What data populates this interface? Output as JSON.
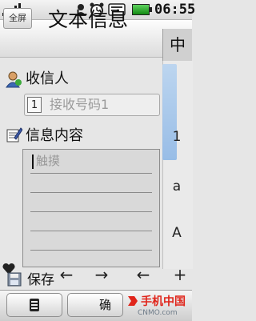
{
  "status_bar": {
    "time": "06:55",
    "icons": [
      "signal-icon",
      "user-icon",
      "alarm-icon",
      "message-icon",
      "battery-icon"
    ]
  },
  "header": {
    "fullscreen_label": "全屏",
    "title": "文本信息",
    "input_mode": "中"
  },
  "recipient": {
    "label": "收信人",
    "index": "1",
    "placeholder": "接收号码1"
  },
  "content": {
    "label": "信息内容",
    "placeholder": "触摸"
  },
  "ime_strip": {
    "keys": [
      "1",
      "a",
      "A"
    ],
    "plus": "+"
  },
  "toolbar": {
    "left_arrow": "←",
    "right_arrow": "→",
    "back_arrow": "←",
    "save_label": "保存"
  },
  "softkeys": {
    "confirm_label": "确"
  },
  "watermark": {
    "brand": "手机中国",
    "url": "CNMO.com"
  },
  "colors": {
    "background": "#e6e6e6",
    "accent": "#e0251b",
    "battery": "#2fa82f"
  }
}
